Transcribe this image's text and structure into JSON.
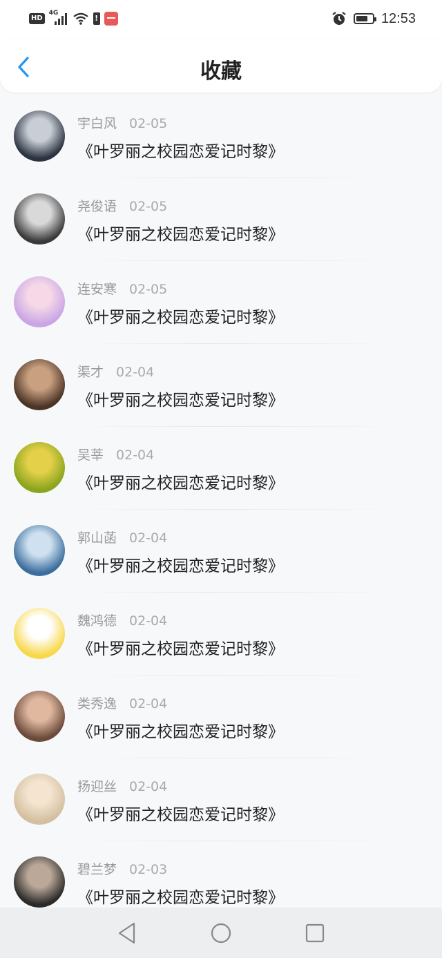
{
  "status_bar": {
    "hd_label": "HD",
    "network": "4G",
    "time": "12:53",
    "icons": [
      "hd-icon",
      "signal-icon",
      "wifi-icon",
      "warning-icon",
      "app-badge-icon",
      "alarm-icon",
      "battery-icon"
    ]
  },
  "header": {
    "title": "收藏",
    "back_icon": "chevron-left-icon",
    "accent": "#2196f3"
  },
  "favorites": [
    {
      "user": "宇白风",
      "date": "02-05",
      "title": "《叶罗丽之校园恋爱记时黎》",
      "avatar_colors": [
        "#2b3340",
        "#c9ced6"
      ]
    },
    {
      "user": "尧俊语",
      "date": "02-05",
      "title": "《叶罗丽之校园恋爱记时黎》",
      "avatar_colors": [
        "#3a3a3a",
        "#d9d9d9"
      ]
    },
    {
      "user": "连安寒",
      "date": "02-05",
      "title": "《叶罗丽之校园恋爱记时黎》",
      "avatar_colors": [
        "#c9a6e6",
        "#f6d8e6"
      ]
    },
    {
      "user": "渠才",
      "date": "02-04",
      "title": "《叶罗丽之校园恋爱记时黎》",
      "avatar_colors": [
        "#4a3426",
        "#c9a080"
      ]
    },
    {
      "user": "吴莘",
      "date": "02-04",
      "title": "《叶罗丽之校园恋爱记时黎》",
      "avatar_colors": [
        "#8aa51e",
        "#e5d04a"
      ]
    },
    {
      "user": "郭山菡",
      "date": "02-04",
      "title": "《叶罗丽之校园恋爱记时黎》",
      "avatar_colors": [
        "#3b6e9e",
        "#cfe1f0"
      ]
    },
    {
      "user": "魏鸿德",
      "date": "02-04",
      "title": "《叶罗丽之校园恋爱记时黎》",
      "avatar_colors": [
        "#f8d84a",
        "#ffffff"
      ]
    },
    {
      "user": "类秀逸",
      "date": "02-04",
      "title": "《叶罗丽之校园恋爱记时黎》",
      "avatar_colors": [
        "#6b4a3a",
        "#e0b8a0"
      ]
    },
    {
      "user": "扬迎丝",
      "date": "02-04",
      "title": "《叶罗丽之校园恋爱记时黎》",
      "avatar_colors": [
        "#d4c0a0",
        "#f4e4d0"
      ]
    },
    {
      "user": "碧兰梦",
      "date": "02-03",
      "title": "《叶罗丽之校园恋爱记时黎》",
      "avatar_colors": [
        "#2a2a2a",
        "#bba898"
      ]
    }
  ],
  "nav_bar": {
    "buttons": [
      "back-triangle-icon",
      "home-circle-icon",
      "recents-square-icon"
    ]
  }
}
